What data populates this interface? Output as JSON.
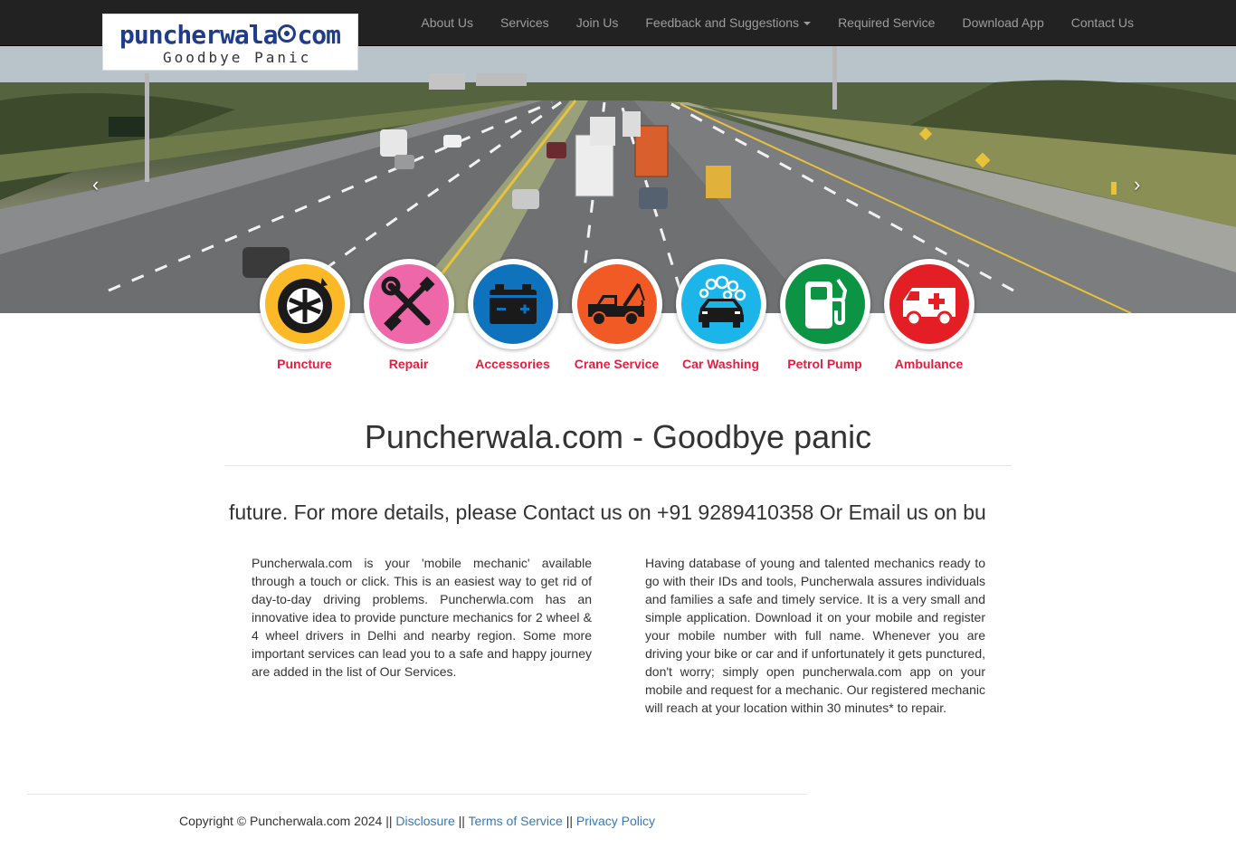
{
  "brand": {
    "name_part1": "puncherwala",
    "name_part2": "com",
    "tagline": "Goodbye Panic"
  },
  "nav": {
    "items": [
      {
        "label": "About Us"
      },
      {
        "label": "Services"
      },
      {
        "label": "Join Us"
      },
      {
        "label": "Feedback and Suggestions",
        "dropdown": true
      },
      {
        "label": "Required Service"
      },
      {
        "label": "Download App"
      },
      {
        "label": "Contact Us"
      }
    ]
  },
  "carousel": {
    "prev_glyph": "‹",
    "next_glyph": "›"
  },
  "services": [
    {
      "label": "Puncture",
      "color": "#fbb928",
      "icon": "wheel-icon"
    },
    {
      "label": "Repair",
      "color": "#ee67a9",
      "icon": "tools-icon"
    },
    {
      "label": "Accessories",
      "color": "#0f72bc",
      "icon": "battery-icon"
    },
    {
      "label": "Crane Service",
      "color": "#f15a24",
      "icon": "tow-truck-icon"
    },
    {
      "label": "Car Washing",
      "color": "#1cb5e9",
      "icon": "car-wash-icon"
    },
    {
      "label": "Petrol Pump",
      "color": "#0c9444",
      "icon": "fuel-pump-icon"
    },
    {
      "label": "Ambulance",
      "color": "#e41e25",
      "icon": "ambulance-icon"
    }
  ],
  "main": {
    "title": "Puncherwala.com - Goodbye panic",
    "marquee": "future. For more details, please Contact us on +91 9289410358 Or Email us on bu",
    "para_left": "Puncherwala.com is your 'mobile mechanic' available through a touch or click. This is an easiest way to get rid of day-to-day driving problems. Puncherwla.com has an innovative idea to provide puncture mechanics for 2 wheel & 4 wheel drivers in Delhi and nearby region. Some more important services can lead you to a safe and happy journey are added in the list of Our Services.",
    "para_right": "Having database of young and talented mechanics ready to go with their IDs and tools, Puncherwala assures individuals and families a safe and timely service. It is a very small and simple application. Download it on your mobile and register your mobile number with full name. Whenever you are driving your bike or car and if unfortunately it gets punctured, don't worry; simply open puncherwala.com app on your mobile and request for a mechanic. Our registered mechanic will reach at your location within 30 minutes* to repair."
  },
  "footer": {
    "copyright": "Copyright © Puncherwala.com 2024 ||",
    "sep": "||",
    "disclosure": "Disclosure",
    "terms": "Terms of Service",
    "privacy": "Privacy Policy"
  },
  "colors": {
    "navbar_bg": "#222222",
    "nav_text": "#9d9d9d",
    "service_label": "#e41e3f",
    "link": "#337ab7",
    "brand_blue": "#1f3d8a"
  }
}
